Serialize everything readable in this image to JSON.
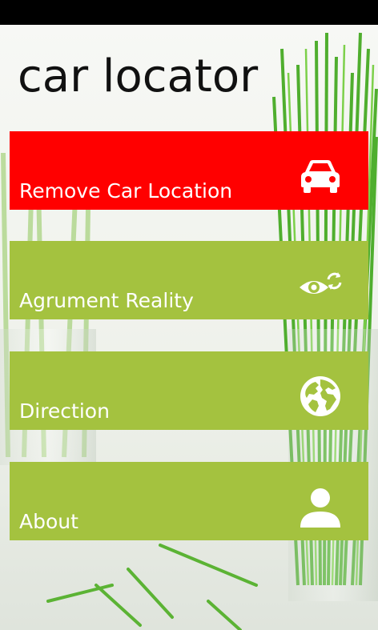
{
  "app": {
    "title": "car locator"
  },
  "menu": {
    "items": [
      {
        "label": "Remove Car Location",
        "icon": "car-icon",
        "color": "#ff0000"
      },
      {
        "label": "Agrument Reality",
        "icon": "eye-refresh-icon",
        "color": "#a4c23f"
      },
      {
        "label": "Direction",
        "icon": "globe-icon",
        "color": "#a4c23f"
      },
      {
        "label": "About",
        "icon": "person-icon",
        "color": "#a4c23f"
      }
    ]
  },
  "theme": {
    "status_bar": "#000000",
    "accent_red": "#ff0000",
    "accent_green": "#a4c23f",
    "text_dark": "#111111",
    "text_light": "#ffffff"
  }
}
